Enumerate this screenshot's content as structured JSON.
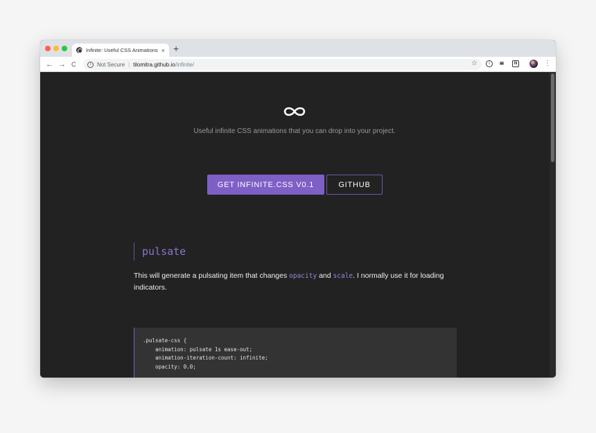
{
  "browser": {
    "tab_title": "Infinite: Useful CSS Animations",
    "tab_close": "×",
    "new_tab": "+",
    "nav": {
      "back": "←",
      "forward": "→",
      "reload": "C"
    },
    "address": {
      "security_label": "Not Secure",
      "separator": "|",
      "host": "tilomitra.github.io",
      "path": "/infinite/"
    },
    "star": "☆",
    "extensions": [
      "i",
      "≋",
      "N"
    ],
    "menu": "⋮"
  },
  "hero": {
    "logo_icon": "infinity-icon",
    "tagline": "Useful infinite CSS animations that you can drop into your project.",
    "primary_button": "GET INFINITE.CSS V0.1",
    "secondary_button": "GITHUB"
  },
  "section": {
    "heading": "pulsate",
    "desc_1": "This will generate a pulsating item that changes ",
    "code_1": "opacity",
    "desc_2": " and ",
    "code_2": "scale",
    "desc_3": ". I normally use it for loading indicators.",
    "faint_mark": "",
    "code": ".pulsate-css {\n    animation: pulsate 1s ease-out;\n    animation-iteration-count: infinite;\n    opacity: 0.0;"
  },
  "colors": {
    "page_bg": "#222222",
    "accent": "#7e5fc6",
    "code_bg": "#333333"
  }
}
